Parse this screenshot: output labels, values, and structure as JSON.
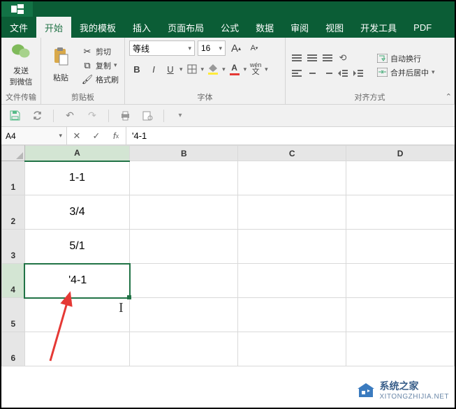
{
  "tabs": {
    "file": "文件",
    "home": "开始",
    "template": "我的模板",
    "insert": "插入",
    "pagelayout": "页面布局",
    "formulas": "公式",
    "data": "数据",
    "review": "审阅",
    "view": "视图",
    "developer": "开发工具",
    "pdf": "PDF"
  },
  "ribbon": {
    "wechat": {
      "send": "发送",
      "to": "到微信",
      "transfer": "文件传输"
    },
    "clipboard": {
      "paste": "粘贴",
      "cut": "剪切",
      "copy": "复制",
      "format_painter": "格式刷",
      "group": "剪贴板"
    },
    "font": {
      "name": "等线",
      "size": "16",
      "group": "字体",
      "grow": "A",
      "shrink": "A"
    },
    "alignment": {
      "wrap": "自动换行",
      "merge": "合并后居中",
      "group": "对齐方式"
    }
  },
  "formula_bar": {
    "name_box": "A4",
    "formula": "'4-1"
  },
  "columns": [
    "A",
    "B",
    "C",
    "D"
  ],
  "rows": [
    "1",
    "2",
    "3",
    "4",
    "5",
    "6"
  ],
  "cells": {
    "A1": "1-1",
    "A2": "3/4",
    "A3": "5/1",
    "A4": "'4-1"
  },
  "watermark": {
    "title": "系统之家",
    "url": "XITONGZHIJIA.NET"
  }
}
